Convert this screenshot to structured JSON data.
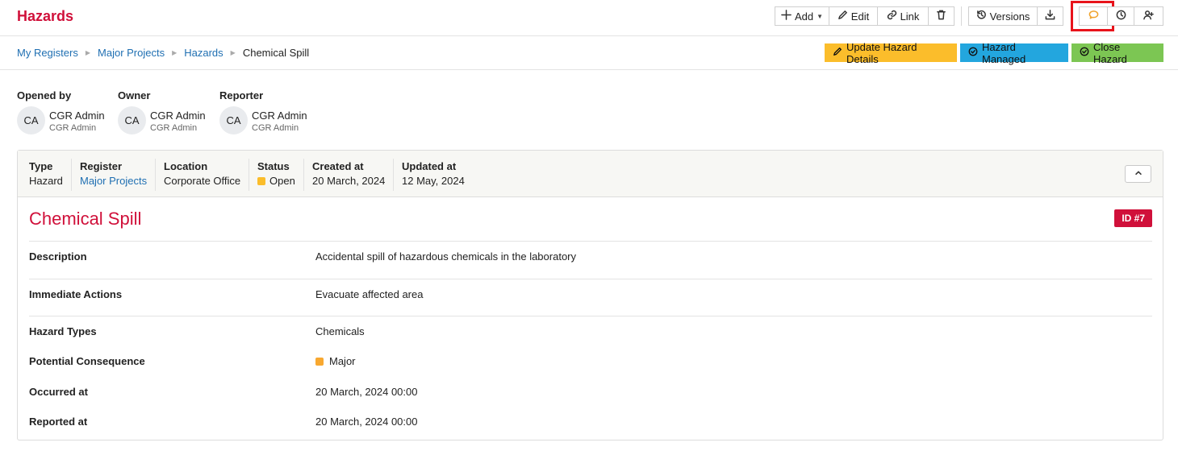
{
  "app": {
    "title": "Hazards"
  },
  "toolbar": {
    "add_label": "Add",
    "edit_label": "Edit",
    "link_label": "Link",
    "versions_label": "Versions"
  },
  "breadcrumb": {
    "items": [
      "My Registers",
      "Major Projects",
      "Hazards"
    ],
    "current": "Chemical Spill"
  },
  "actions": {
    "update_label": "Update Hazard Details",
    "managed_label": "Hazard Managed",
    "close_label": "Close Hazard"
  },
  "people": [
    {
      "role": "Opened by",
      "initials": "CA",
      "name": "CGR Admin",
      "sub": "CGR Admin"
    },
    {
      "role": "Owner",
      "initials": "CA",
      "name": "CGR Admin",
      "sub": "CGR Admin"
    },
    {
      "role": "Reporter",
      "initials": "CA",
      "name": "CGR Admin",
      "sub": "CGR Admin"
    }
  ],
  "meta": {
    "type_label": "Type",
    "type_value": "Hazard",
    "register_label": "Register",
    "register_value": "Major Projects",
    "location_label": "Location",
    "location_value": "Corporate Office",
    "status_label": "Status",
    "status_value": "Open",
    "status_color": "#fbbd2b",
    "created_label": "Created at",
    "created_value": "20 March, 2024",
    "updated_label": "Updated at",
    "updated_value": "12 May, 2024"
  },
  "hazard": {
    "title": "Chemical Spill",
    "id_badge": "ID #7",
    "details": [
      {
        "label": "Description",
        "value": "Accidental spill of hazardous chemicals in the laboratory"
      },
      {
        "label": "Immediate Actions",
        "value": "Evacuate affected area"
      },
      {
        "label": "Hazard Types",
        "value": "Chemicals"
      },
      {
        "label": "Potential Consequence",
        "value": "Major"
      },
      {
        "label": "Occurred at",
        "value": "20 March, 2024 00:00"
      },
      {
        "label": "Reported at",
        "value": "20 March, 2024 00:00"
      }
    ]
  },
  "colors": {
    "brand": "#d0103a",
    "link": "#1f6fb2",
    "update": "#fbbd2b",
    "managed": "#23a6de",
    "close": "#7cc653",
    "highlight": "#e8131b"
  }
}
